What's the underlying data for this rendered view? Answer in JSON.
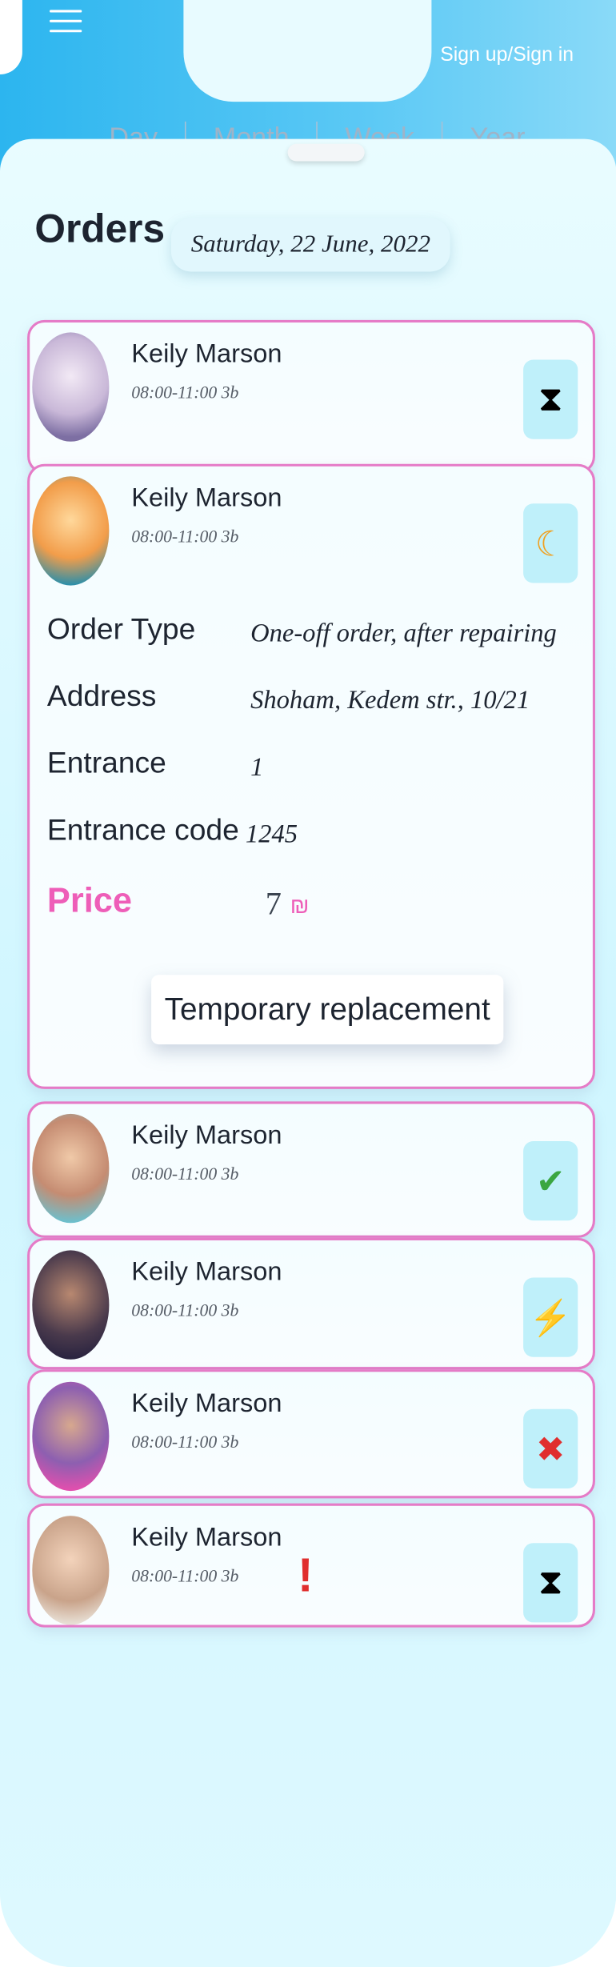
{
  "header": {
    "signin_label": "Sign up/Sign in",
    "tabs": [
      "Day",
      "Month",
      "Week",
      "Year"
    ]
  },
  "page": {
    "title": "Orders",
    "date": "Saturday, 22 June, 2022"
  },
  "orders": [
    {
      "name": "Keily Marson",
      "meta": "08:00-11:00 3b",
      "status_icon": "hourglass-icon"
    },
    {
      "name": "Keily Marson",
      "meta": "08:00-11:00 3b",
      "status_icon": "moon-star-icon",
      "details": {
        "order_type_label": "Order Type",
        "order_type_value": "One-off order, after repairing",
        "address_label": "Address",
        "address_value": "Shoham, Kedem str., 10/21",
        "entrance_label": "Entrance",
        "entrance_value": "1",
        "code_label": "Entrance code",
        "code_value": "1245",
        "price_label": "Price",
        "price_value": "7",
        "currency": "₪",
        "action_label": "Temporary replacement"
      }
    },
    {
      "name": "Keily Marson",
      "meta": "08:00-11:00 3b",
      "status_icon": "checkmark-icon"
    },
    {
      "name": "Keily Marson",
      "meta": "08:00-11:00 3b",
      "status_icon": "lightning-icon"
    },
    {
      "name": "Keily Marson",
      "meta": "08:00-11:00 3b",
      "status_icon": "cross-icon"
    },
    {
      "name": "Keily Marson",
      "meta": "08:00-11:00 3b",
      "status_icon": "hourglass-icon",
      "alert": "!"
    }
  ],
  "colors": {
    "accent": "#2cb5ef",
    "pink": "#e57bc7",
    "price": "#ee5eb8"
  }
}
